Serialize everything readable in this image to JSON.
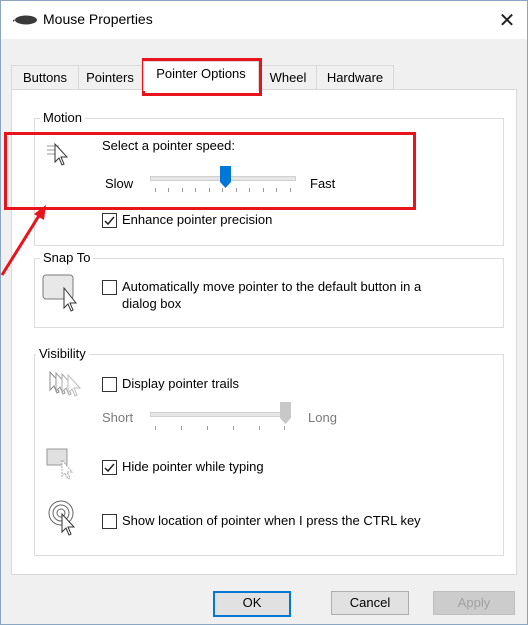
{
  "window": {
    "title": "Mouse Properties",
    "close_glyph": "✕"
  },
  "tabs": [
    {
      "label": "Buttons"
    },
    {
      "label": "Pointers"
    },
    {
      "label": "Pointer Options",
      "active": true
    },
    {
      "label": "Wheel"
    },
    {
      "label": "Hardware"
    }
  ],
  "motion": {
    "label": "Motion",
    "speed_label": "Select a pointer speed:",
    "slow_label": "Slow",
    "fast_label": "Fast",
    "speed_value": 0.55,
    "precision_label": "Enhance pointer precision",
    "precision_checked": true
  },
  "snap_to": {
    "label": "Snap To",
    "checkbox_label_line1": "Automatically move pointer to the default button in a",
    "checkbox_label_line2": "dialog box",
    "checked": false
  },
  "visibility": {
    "label": "Visibility",
    "trails_label": "Display pointer trails",
    "trails_checked": false,
    "short_label": "Short",
    "long_label": "Long",
    "trail_value": 1.0,
    "hide_label": "Hide pointer while typing",
    "hide_checked": true,
    "ctrl_label": "Show location of pointer when I press the CTRL key",
    "ctrl_checked": false
  },
  "buttons": {
    "ok": "OK",
    "cancel": "Cancel",
    "apply": "Apply"
  },
  "colors": {
    "highlight": "#e8131b",
    "accent": "#0078d7"
  },
  "icons": [
    "mouse-icon",
    "pointer-speed-icon",
    "snap-to-icon",
    "pointer-trails-icon",
    "hide-pointer-icon",
    "pointer-location-icon"
  ]
}
